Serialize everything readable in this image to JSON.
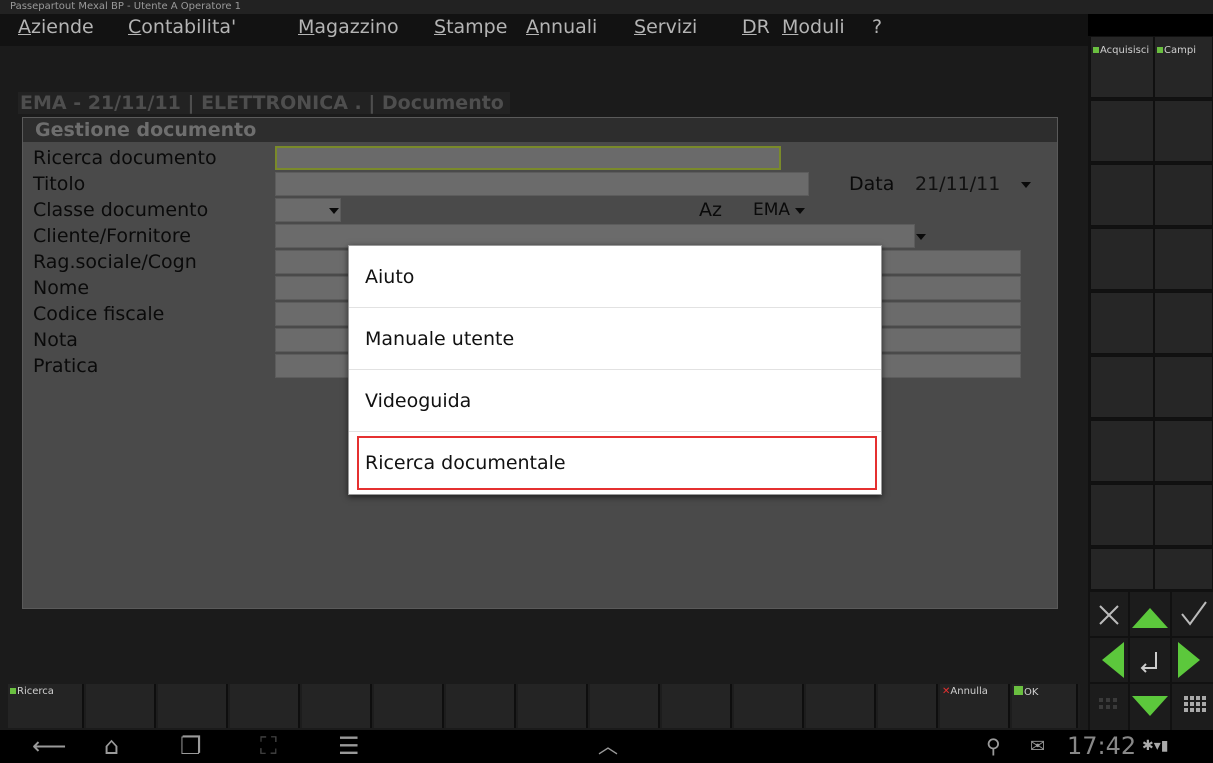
{
  "window": {
    "title": "Passepartout Mexal BP - Utente A Operatore 1"
  },
  "menu": {
    "items": [
      "Aziende",
      "Contabilita'",
      "Magazzino",
      "Stampe",
      "Annuali",
      "Servizi",
      "DR",
      "Moduli",
      "?"
    ]
  },
  "breadcrumb": "EMA - 21/11/11 | ELETTRONICA . | Documento",
  "form": {
    "title": "Gestione documento",
    "labels": {
      "ricerca": "Ricerca documento",
      "titolo": "Titolo",
      "classe": "Classe documento",
      "cliente": "Cliente/Fornitore",
      "ragsoc": "Rag.sociale/Cogn",
      "nome": "Nome",
      "cf": "Codice fiscale",
      "nota": "Nota",
      "pratica": "Pratica"
    },
    "data_label": "Data",
    "data_value": "21/11/11",
    "az_label": "Az",
    "az_value": "EMA"
  },
  "popup": {
    "items": [
      "Aiuto",
      "Manuale utente",
      "Videoguida",
      "Ricerca documentale"
    ],
    "highlighted": "Ricerca documentale"
  },
  "fkeys": {
    "ricerca": "Ricerca",
    "annulla": "Annulla",
    "ok": "OK"
  },
  "side": {
    "acquisisci": "Acquisisci",
    "campi": "Campi"
  },
  "status": {
    "clock": "17:42"
  },
  "colors": {
    "highlight": "#e53030",
    "accent_green": "#6abf40",
    "annulla_x": "#e53030"
  }
}
